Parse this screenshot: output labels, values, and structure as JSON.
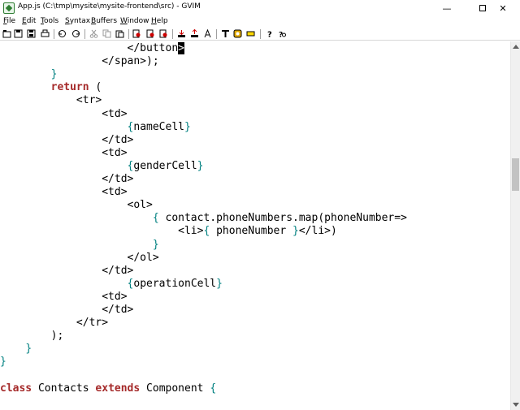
{
  "window": {
    "title": "App.js (C:\\tmp\\mysite\\mysite-frontend\\src) - GVIM",
    "minimize_glyph": "—",
    "close_glyph": "✕"
  },
  "menu": [
    {
      "label": "File",
      "u": "F",
      "rest": "ile"
    },
    {
      "label": "Edit",
      "u": "E",
      "rest": "dit"
    },
    {
      "label": "Tools",
      "u": "T",
      "rest": "ools"
    },
    {
      "label": "Syntax",
      "u": "S",
      "rest": "yntax"
    },
    {
      "label": "Buffers",
      "u": "B",
      "rest": "uffers"
    },
    {
      "label": "Window",
      "u": "W",
      "rest": "indow"
    },
    {
      "label": "Help",
      "u": "H",
      "rest": "elp"
    }
  ],
  "toolbar": {
    "icons": [
      "open-icon",
      "save-icon",
      "save-all-icon",
      "print-icon",
      "undo-icon",
      "redo-icon",
      "cut-icon",
      "copy-icon",
      "paste-icon",
      "find-icon",
      "find-next-icon",
      "find-prev-icon",
      "load-session-icon",
      "save-session-icon",
      "run-script-icon",
      "make-icon",
      "shell-icon",
      "tags-icon",
      "help-icon",
      "find-help-icon"
    ]
  },
  "colors": {
    "keyword": "#a52a2a",
    "brace": "#008080",
    "text": "#000000"
  },
  "code_lines": [
    [
      {
        "t": "                    </button"
      },
      {
        "t": ">",
        "c": "cursor"
      }
    ],
    [
      {
        "t": "                </span>);"
      }
    ],
    [
      {
        "t": "        "
      },
      {
        "t": "}",
        "c": "br"
      }
    ],
    [
      {
        "t": "        "
      },
      {
        "t": "return",
        "c": "kw"
      },
      {
        "t": " ("
      }
    ],
    [
      {
        "t": "            <tr>"
      }
    ],
    [
      {
        "t": "                <td>"
      }
    ],
    [
      {
        "t": "                    "
      },
      {
        "t": "{",
        "c": "br"
      },
      {
        "t": "nameCell"
      },
      {
        "t": "}",
        "c": "br"
      }
    ],
    [
      {
        "t": "                </td>"
      }
    ],
    [
      {
        "t": "                <td>"
      }
    ],
    [
      {
        "t": "                    "
      },
      {
        "t": "{",
        "c": "br"
      },
      {
        "t": "genderCell"
      },
      {
        "t": "}",
        "c": "br"
      }
    ],
    [
      {
        "t": "                </td>"
      }
    ],
    [
      {
        "t": "                <td>"
      }
    ],
    [
      {
        "t": "                    <ol>"
      }
    ],
    [
      {
        "t": "                        "
      },
      {
        "t": "{",
        "c": "br"
      },
      {
        "t": " contact.phoneNumbers.map(phoneNumber=>"
      }
    ],
    [
      {
        "t": "                            <li>"
      },
      {
        "t": "{",
        "c": "br"
      },
      {
        "t": " phoneNumber "
      },
      {
        "t": "}",
        "c": "br"
      },
      {
        "t": "</li>)"
      }
    ],
    [
      {
        "t": "                        "
      },
      {
        "t": "}",
        "c": "br"
      }
    ],
    [
      {
        "t": "                    </ol>"
      }
    ],
    [
      {
        "t": "                </td>"
      }
    ],
    [
      {
        "t": "                    "
      },
      {
        "t": "{",
        "c": "br"
      },
      {
        "t": "operationCell"
      },
      {
        "t": "}",
        "c": "br"
      }
    ],
    [
      {
        "t": "                <td>"
      }
    ],
    [
      {
        "t": "                </td>"
      }
    ],
    [
      {
        "t": "            </tr>"
      }
    ],
    [
      {
        "t": "        );"
      }
    ],
    [
      {
        "t": "    "
      },
      {
        "t": "}",
        "c": "br"
      }
    ],
    [
      {
        "t": "}",
        "c": "br"
      }
    ],
    [
      {
        "t": ""
      }
    ],
    [
      {
        "t": "class",
        "c": "kw"
      },
      {
        "t": " Contacts "
      },
      {
        "t": "extends",
        "c": "kw"
      },
      {
        "t": " Component "
      },
      {
        "t": "{",
        "c": "br"
      }
    ]
  ]
}
